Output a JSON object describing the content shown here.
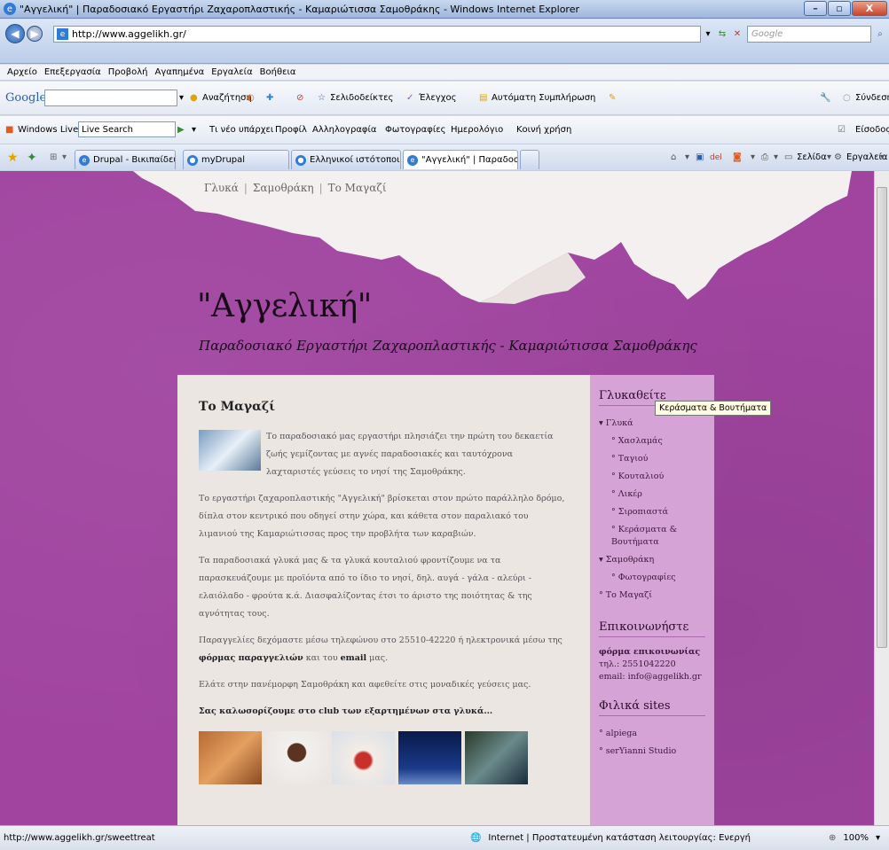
{
  "window": {
    "title": "\"Αγγελική\" | Παραδοσιακό Εργαστήρι Ζαχαροπλαστικής - Καμαριώτισσα Σαμοθράκης - Windows Internet Explorer"
  },
  "address": {
    "url": "http://www.aggelikh.gr/",
    "search_placeholder": "Google"
  },
  "menu": [
    "Αρχείο",
    "Επεξεργασία",
    "Προβολή",
    "Αγαπημένα",
    "Εργαλεία",
    "Βοήθεια"
  ],
  "google_toolbar": {
    "logo": "Google",
    "search": "Αναζήτηση",
    "bookmarks": "Σελιδοδείκτες",
    "check": "Έλεγχος",
    "autofill": "Αυτόματη Συμπλήρωση",
    "signin": "Σύνδεση"
  },
  "live_toolbar": {
    "brand": "Windows Live",
    "search_value": "Live Search",
    "links": [
      "Τι νέο υπάρχει",
      "Προφίλ",
      "Αλληλογραφία",
      "Φωτογραφίες",
      "Ημερολόγιο",
      "Κοινή χρήση"
    ],
    "login": "Είσοδος"
  },
  "tabs": [
    {
      "label": "Drupal - Βικιπαίδεια",
      "active": false
    },
    {
      "label": "myDrupal",
      "active": false
    },
    {
      "label": "Ελληνικοί ιστότοποι ( web...",
      "active": false
    },
    {
      "label": "\"Αγγελική\" | Παραδοσι...",
      "active": true
    }
  ],
  "command_bar": {
    "page": "Σελίδα",
    "tools": "Εργαλεία"
  },
  "site": {
    "topnav": [
      "Γλυκά",
      "Σαμοθράκη",
      "Το Μαγαζί"
    ],
    "title": "\"Αγγελική\"",
    "slogan": "Παραδοσιακό Εργαστήρι Ζαχαροπλαστικής - Καμαριώτισσα Σαμοθράκης"
  },
  "article": {
    "heading": "Το Μαγαζί",
    "p1": "Το παραδοσιακό μας εργαστήρι πλησιάζει την πρώτη του δεκαετία ζωής γεμίζοντας με αγνές παραδοσιακές και ταυτόχρονα λαχταριστές γεύσεις το νησί της Σαμοθράκης.",
    "p2": "Το εργαστήρι ζαχαροπλαστικής \"Αγγελική\" βρίσκεται στον πρώτο παράλληλο δρόμο, δίπλα στον κεντρικό που οδηγεί στην χώρα, και κάθετα στον παραλιακό του λιμανιού της Καμαριώτισσας προς την προβλήτα των καραβιών.",
    "p3": "Τα παραδοσιακά γλυκά μας & τα γλυκά κουταλιού φροντίζουμε να τα παρασκευάζουμε με προϊόντα από το ίδιο το νησί, δηλ. αυγά - γάλα - αλεύρι - ελαιόλαδο - φρούτα κ.ά. Διασφαλίζοντας έτσι το άριστο της ποιότητας & της αγνότητας τους.",
    "p4_a": "Παραγγελίες δεχόμαστε μέσω τηλεφώνου στο 25510-42220 ή ηλεκτρονικά μέσω της",
    "p4_link": "φόρμας παραγγελιών",
    "p4_b": "και του",
    "p4_email": "email",
    "p4_c": "μας.",
    "p5": "Ελάτε στην πανέμορφη Σαμοθράκη και αφεθείτε στις μοναδικές γεύσεις μας.",
    "p6_a": "Σας καλωσορίζουμε στο",
    "p6_club": "club",
    "p6_b": "των εξαρτημένων στα γλυκά..."
  },
  "sidebar": {
    "h1": "Γλυκαθείτε",
    "sweets": "Γλυκά",
    "sweets_items": [
      "Χασλαμάς",
      "Ταγιού",
      "Κουταλιού",
      "Λικέρ",
      "Σιροπιαστά",
      "Κεράσματα & Βουτήματα"
    ],
    "samothraki": "Σαμοθράκη",
    "samothraki_items": [
      "Φωτογραφίες"
    ],
    "shop": "Το Μαγαζί",
    "h2": "Επικοινωνήστε",
    "contact_form": "φόρμα επικοινωνίας",
    "phone": "τηλ.: 2551042220",
    "email": "email: info@aggelikh.gr",
    "h3": "Φιλικά sites",
    "friends": [
      "alpiega",
      "serYianni Studio"
    ]
  },
  "tooltip": "Κεράσματα & Βουτήματα",
  "status": {
    "url": "http://www.aggelikh.gr/sweettreat",
    "zone": "Internet | Προστατευμένη κατάσταση λειτουργίας: Ενεργή",
    "zoom": "100%"
  }
}
